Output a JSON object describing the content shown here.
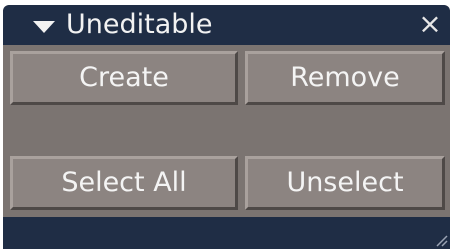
{
  "panel": {
    "title": "Uneditable",
    "close_glyph": "×",
    "icons": [
      "collapse-triangle-icon",
      "close-icon",
      "resize-grip-icon"
    ]
  },
  "buttons": {
    "create": "Create",
    "remove": "Remove",
    "select_all": "Select All",
    "unselect": "Unselect"
  },
  "colors": {
    "titlebar": "#1f2d45",
    "panel_bg": "#7b7471",
    "button_face": "#8c8481",
    "text": "#f4f4f4"
  }
}
